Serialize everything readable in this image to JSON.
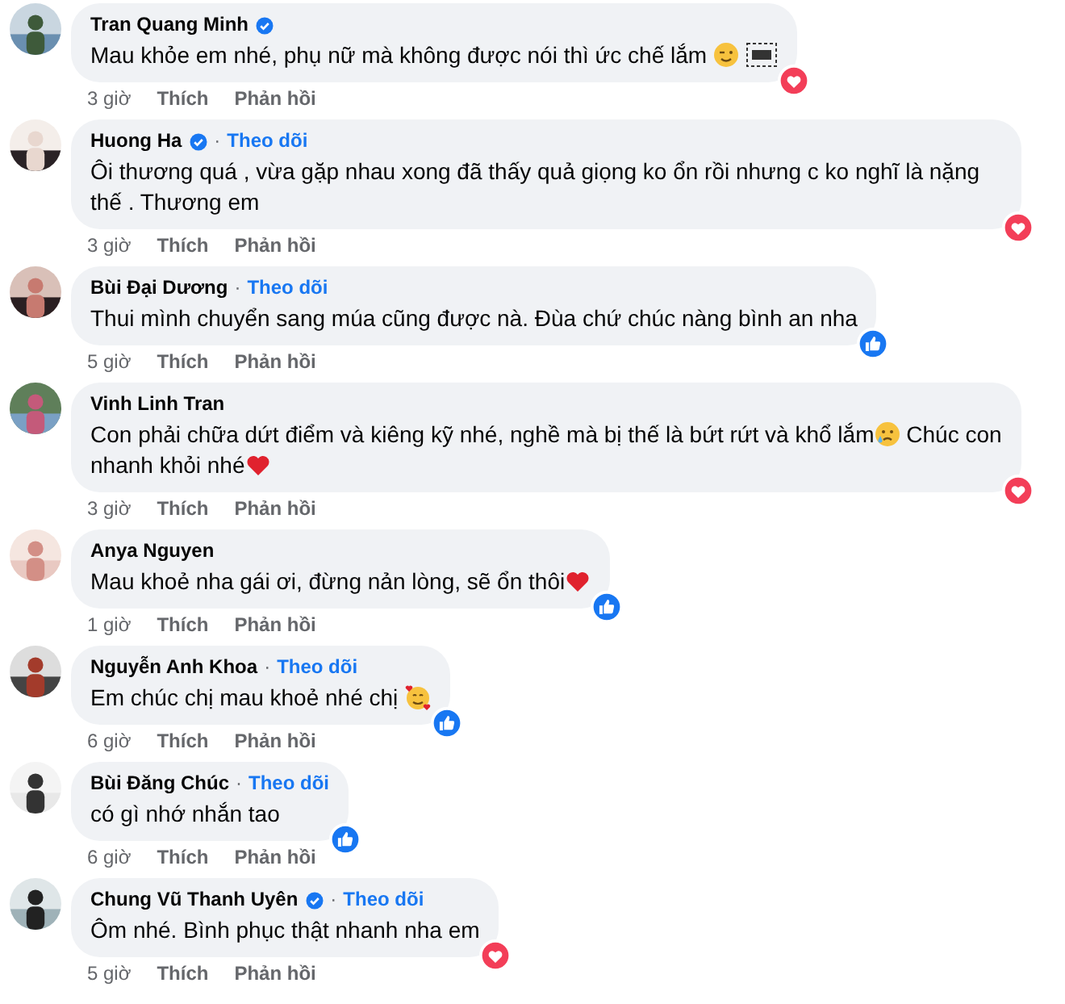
{
  "comments": [
    {
      "name": "Tran Quang Minh",
      "verified": true,
      "reaction": {
        "kind": "love"
      },
      "time": "3 giờ",
      "like": "Thích",
      "reply": "Phản hồi",
      "parts": [
        {
          "kind": "text",
          "text": "Mau khỏe em nhé, phụ nữ mà không được nói thì ức chế lắm "
        },
        {
          "kind": "wink"
        },
        {
          "kind": "obj"
        }
      ]
    },
    {
      "name": "Huong Ha",
      "verified": true,
      "separator": "·",
      "follow": "Theo dõi",
      "reaction": {
        "kind": "love"
      },
      "time": "3 giờ",
      "like": "Thích",
      "reply": "Phản hồi",
      "parts": [
        {
          "kind": "text",
          "text": "Ôi thương quá , vừa gặp nhau xong đã thấy quả giọng ko ổn rồi nhưng c ko nghĩ là nặng thế . Thương em"
        }
      ]
    },
    {
      "name": "Bùi Đại Dương",
      "verified": false,
      "separator": "·",
      "follow": "Theo dõi",
      "reaction": {
        "kind": "like"
      },
      "time": "5 giờ",
      "like": "Thích",
      "reply": "Phản hồi",
      "parts": [
        {
          "kind": "text",
          "text": "Thui mình chuyển sang múa cũng được nà. Đùa chứ chúc nàng bình an nha"
        }
      ]
    },
    {
      "name": "Vinh Linh Tran",
      "verified": false,
      "reaction": {
        "kind": "love"
      },
      "time": "3 giờ",
      "like": "Thích",
      "reply": "Phản hồi",
      "parts": [
        {
          "kind": "text",
          "text": "Con phải chữa dứt điểm và kiêng kỹ nhé, nghề mà bị thế là bứt rứt và khổ lắm"
        },
        {
          "kind": "tear"
        },
        {
          "kind": "text",
          "text": " Chúc con nhanh khỏi nhé"
        },
        {
          "kind": "heart"
        }
      ]
    },
    {
      "name": "Anya Nguyen",
      "verified": false,
      "reaction": {
        "kind": "like"
      },
      "time": "1 giờ",
      "like": "Thích",
      "reply": "Phản hồi",
      "parts": [
        {
          "kind": "text",
          "text": "Mau khoẻ nha gái ơi, đừng nản lòng, sẽ ổn thôi"
        },
        {
          "kind": "heart"
        }
      ]
    },
    {
      "name": "Nguyễn Anh Khoa",
      "verified": false,
      "separator": "·",
      "follow": "Theo dõi",
      "reaction": {
        "kind": "like"
      },
      "time": "6 giờ",
      "like": "Thích",
      "reply": "Phản hồi",
      "parts": [
        {
          "kind": "text",
          "text": "Em chúc chị mau khoẻ nhé chị "
        },
        {
          "kind": "hearts-face"
        }
      ]
    },
    {
      "name": "Bùi Đăng Chúc",
      "verified": false,
      "separator": "·",
      "follow": "Theo dõi",
      "reaction": {
        "kind": "like"
      },
      "time": "6 giờ",
      "like": "Thích",
      "reply": "Phản hồi",
      "parts": [
        {
          "kind": "text",
          "text": "có gì nhớ nhắn tao"
        }
      ]
    },
    {
      "name": "Chung Vũ Thanh Uyên",
      "verified": true,
      "separator": "·",
      "follow": "Theo dõi",
      "reaction": {
        "kind": "love"
      },
      "time": "5 giờ",
      "like": "Thích",
      "reply": "Phản hồi",
      "parts": [
        {
          "kind": "text",
          "text": "Ôm nhé. Bình phục thật nhanh nha em"
        }
      ]
    }
  ]
}
